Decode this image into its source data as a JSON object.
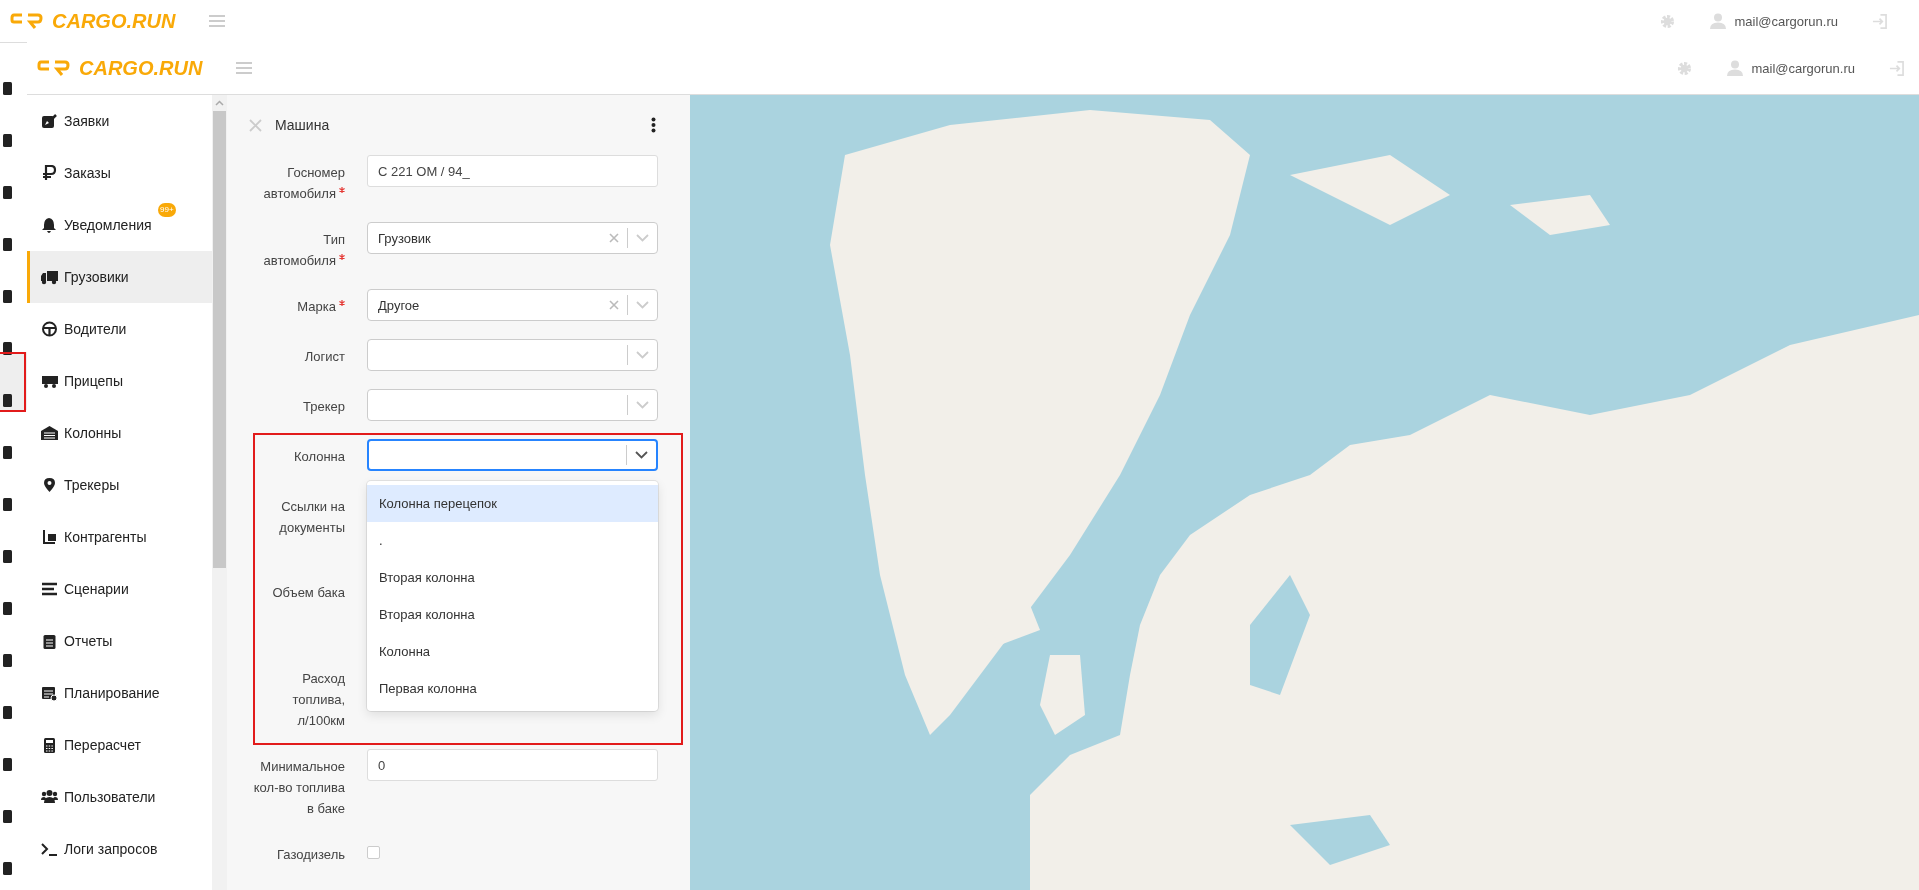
{
  "outer_header": {
    "logo": "CARGO.RUN",
    "user_email": "mail@cargorun.ru"
  },
  "inner_header": {
    "logo": "CARGO.RUN",
    "user_email": "mail@cargorun.ru"
  },
  "sidebar": {
    "items": [
      {
        "label": "Заявки",
        "selected": false
      },
      {
        "label": "Заказы",
        "selected": false
      },
      {
        "label": "Уведомления",
        "selected": false,
        "badge": "99+"
      },
      {
        "label": "Грузовики",
        "selected": true
      },
      {
        "label": "Водители",
        "selected": false
      },
      {
        "label": "Прицепы",
        "selected": false
      },
      {
        "label": "Колонны",
        "selected": false
      },
      {
        "label": "Трекеры",
        "selected": false
      },
      {
        "label": "Контрагенты",
        "selected": false
      },
      {
        "label": "Сценарии",
        "selected": false
      },
      {
        "label": "Отчеты",
        "selected": false
      },
      {
        "label": "Планирование",
        "selected": false
      },
      {
        "label": "Перерасчет",
        "selected": false
      },
      {
        "label": "Пользователи",
        "selected": false
      },
      {
        "label": "Логи запросов",
        "selected": false
      }
    ]
  },
  "form": {
    "title": "Машина",
    "fields": [
      {
        "kind": "text",
        "label": "Госномер автомобиля",
        "required": true,
        "value": "С 221 ОМ / 94_"
      },
      {
        "kind": "select",
        "label": "Тип автомобиля",
        "required": true,
        "value": "Грузовик",
        "clearable": true,
        "focused": false
      },
      {
        "kind": "select",
        "label": "Марка",
        "required": true,
        "value": "Другое",
        "clearable": true,
        "focused": false
      },
      {
        "kind": "select",
        "label": "Логист",
        "required": false,
        "clearable": false,
        "focused": false
      },
      {
        "kind": "select",
        "label": "Трекер",
        "required": false,
        "clearable": false,
        "focused": false
      },
      {
        "kind": "select",
        "label": "Колонна",
        "required": false,
        "clearable": false,
        "focused": true,
        "options": [
          {
            "label": "Колонна перецепок",
            "highlighted": true
          },
          {
            "label": ".",
            "highlighted": false
          },
          {
            "label": "Вторая колонна",
            "highlighted": false
          },
          {
            "label": "Вторая колонна",
            "highlighted": false
          },
          {
            "label": "Колонна",
            "highlighted": false
          },
          {
            "label": "Первая колонна",
            "highlighted": false
          }
        ]
      },
      {
        "kind": "covered",
        "label": "Ссылки на документы",
        "required": false
      },
      {
        "kind": "covered",
        "label": "Объем бака",
        "required": false
      },
      {
        "kind": "covered",
        "label": "Расход топлива, л/100км",
        "required": false
      },
      {
        "kind": "text",
        "label": "Минимальное кол-во топлива в баке",
        "required": false,
        "value": "0"
      },
      {
        "kind": "checkbox",
        "label": "Газодизель",
        "required": false,
        "checked": false
      }
    ]
  }
}
